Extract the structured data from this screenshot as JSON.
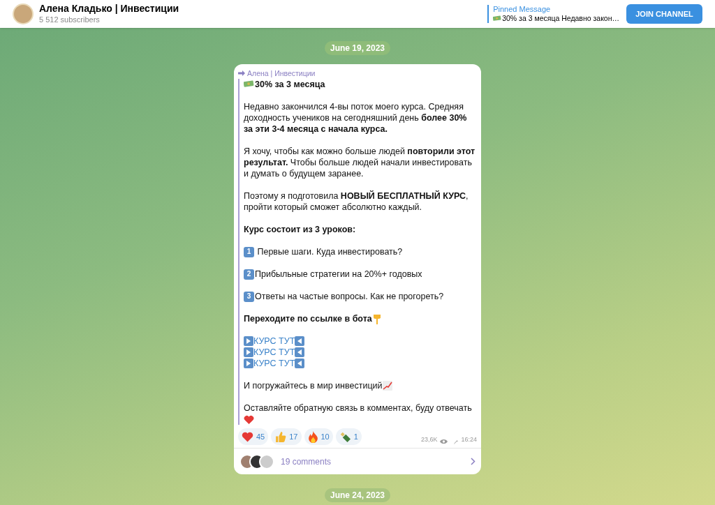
{
  "header": {
    "channel_name": "Алена Кладько | Инвестиции",
    "subscribers": "5 512 subscribers",
    "pinned": {
      "label": "Pinned Message",
      "text": "30% за 3 месяца Недавно закон…"
    },
    "join_button": "JOIN CHANNEL"
  },
  "dates": [
    "June 19, 2023",
    "June 24, 2023"
  ],
  "post": {
    "forwarded_from": "Алена | Инвестиции",
    "blocks": [
      {
        "kind": "title",
        "text": "30% за 3 месяца"
      },
      {
        "kind": "paragraph",
        "text": "Недавно закончился 4-вы поток моего курса. Средняя доходность учеников на сегодняшний день **более 30% за эти 3-4 месяца с начала курса.**"
      },
      {
        "kind": "paragraph",
        "text": "Я хочу, чтобы как можно больше людей **повторили этот результат.** Чтобы больше людей начали инвестировать и думать о будущем заранее."
      },
      {
        "kind": "paragraph",
        "text": "Поэтому я подготовила **НОВЫЙ БЕСПЛАТНЫЙ КУРС**, пройти который сможет абсолютно каждый."
      },
      {
        "kind": "heading",
        "text": "Курс состоит из 3 уроков:"
      },
      {
        "kind": "numbered",
        "number": "1",
        "text": " Первые шаги. Куда инвестировать?"
      },
      {
        "kind": "numbered",
        "number": "2",
        "text": "Прибыльные стратегии на 20%+ годовых"
      },
      {
        "kind": "numbered",
        "number": "3",
        "text": "Ответы на частые вопросы. Как не прогореть?"
      },
      {
        "kind": "pointing",
        "text": "Переходите по ссылке в бота"
      },
      {
        "kind": "links",
        "items": [
          "КУРС ТУТ",
          "КУРС ТУТ",
          "КУРС ТУТ"
        ]
      },
      {
        "kind": "chart_line",
        "text": "И погружайтесь в мир инвестиций"
      },
      {
        "kind": "heart_line",
        "text": "Оставляйте обратную связь в комментах, буду отвечать"
      }
    ],
    "reactions": [
      {
        "kind": "heart",
        "count": "45"
      },
      {
        "kind": "thumbs",
        "count": "17"
      },
      {
        "kind": "fire",
        "count": "10"
      },
      {
        "kind": "bottle",
        "count": "1"
      }
    ],
    "views": "23,6K",
    "time": "16:24",
    "comments": "19 comments"
  }
}
